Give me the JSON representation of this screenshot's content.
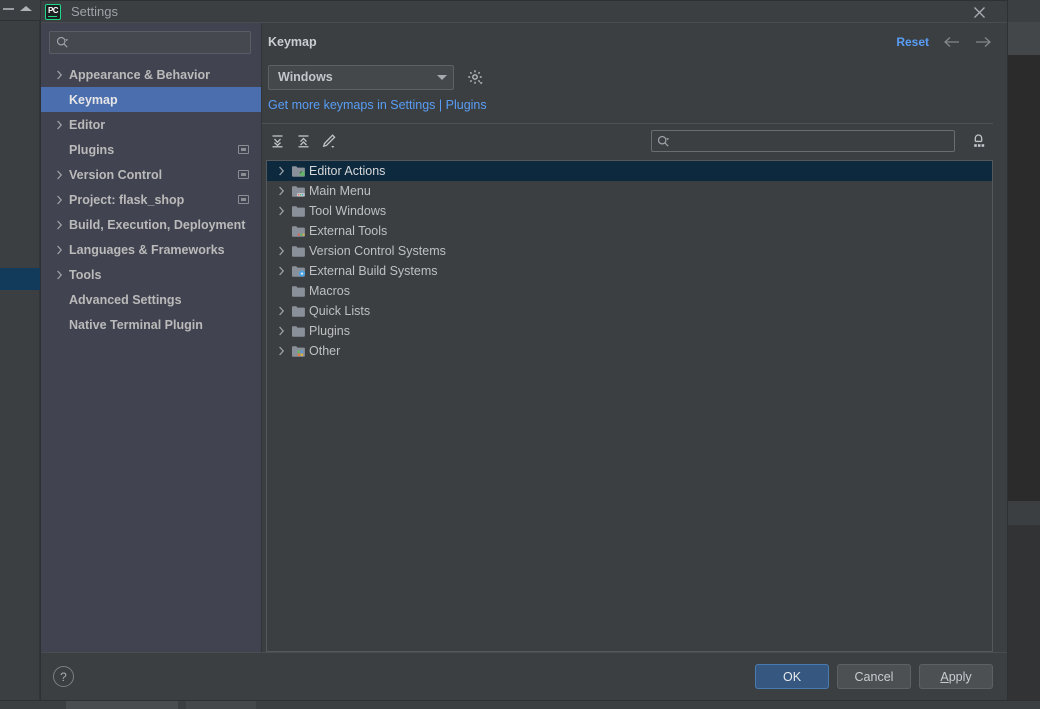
{
  "window": {
    "title": "Settings",
    "app_icon": "pycharm-icon",
    "app_icon_text": "PC",
    "close_icon": "close-icon"
  },
  "sidebar": {
    "search": {
      "value": "",
      "placeholder": "",
      "icon": "search-icon"
    },
    "items": [
      {
        "label": "Appearance & Behavior",
        "expandable": true,
        "selected": false,
        "badge": false
      },
      {
        "label": "Keymap",
        "expandable": false,
        "selected": true,
        "badge": false
      },
      {
        "label": "Editor",
        "expandable": true,
        "selected": false,
        "badge": false
      },
      {
        "label": "Plugins",
        "expandable": false,
        "selected": false,
        "badge": true
      },
      {
        "label": "Version Control",
        "expandable": true,
        "selected": false,
        "badge": true
      },
      {
        "label": "Project: flask_shop",
        "expandable": true,
        "selected": false,
        "badge": true
      },
      {
        "label": "Build, Execution, Deployment",
        "expandable": true,
        "selected": false,
        "badge": false
      },
      {
        "label": "Languages & Frameworks",
        "expandable": true,
        "selected": false,
        "badge": false
      },
      {
        "label": "Tools",
        "expandable": true,
        "selected": false,
        "badge": false
      },
      {
        "label": "Advanced Settings",
        "expandable": false,
        "selected": false,
        "badge": false
      },
      {
        "label": "Native Terminal Plugin",
        "expandable": false,
        "selected": false,
        "badge": false
      }
    ]
  },
  "content": {
    "page_title": "Keymap",
    "reset_label": "Reset",
    "back_icon": "arrow-left-icon",
    "forward_icon": "arrow-right-icon",
    "keymap_select": {
      "value": "Windows",
      "chevron": "chevron-down-icon"
    },
    "gear_icon": "gear-icon",
    "keymaps_link": "Get more keymaps in Settings | Plugins",
    "toolbar": {
      "expand_all_icon": "expand-all-icon",
      "collapse_all_icon": "collapse-all-icon",
      "edit_shortcut_icon": "pencil-edit-icon",
      "find_by_shortcut_icon": "find-by-shortcut-icon",
      "search": {
        "value": "",
        "placeholder": "",
        "icon": "search-icon"
      }
    },
    "tree": [
      {
        "label": "Editor Actions",
        "expandable": true,
        "selected": true,
        "icon": "folder-editor-icon"
      },
      {
        "label": "Main Menu",
        "expandable": true,
        "selected": false,
        "icon": "folder-menu-icon"
      },
      {
        "label": "Tool Windows",
        "expandable": true,
        "selected": false,
        "icon": "folder-icon"
      },
      {
        "label": "External Tools",
        "expandable": false,
        "selected": false,
        "icon": "folder-tools-icon"
      },
      {
        "label": "Version Control Systems",
        "expandable": true,
        "selected": false,
        "icon": "folder-icon"
      },
      {
        "label": "External Build Systems",
        "expandable": true,
        "selected": false,
        "icon": "folder-build-icon"
      },
      {
        "label": "Macros",
        "expandable": false,
        "selected": false,
        "icon": "folder-icon"
      },
      {
        "label": "Quick Lists",
        "expandable": true,
        "selected": false,
        "icon": "folder-icon"
      },
      {
        "label": "Plugins",
        "expandable": true,
        "selected": false,
        "icon": "folder-icon"
      },
      {
        "label": "Other",
        "expandable": true,
        "selected": false,
        "icon": "folder-other-icon"
      }
    ]
  },
  "footer": {
    "help_label": "?",
    "ok_label": "OK",
    "cancel_label": "Cancel",
    "apply_label_prefix": "A",
    "apply_label_rest": "pply"
  },
  "colors": {
    "accent_link": "#589DF6",
    "sidebar_selected": "#4B6EAF",
    "tree_selected": "#0D293E",
    "primary_button": "#365880",
    "dialog_bg": "#3C3F41",
    "sidebar_bg": "#414450",
    "brand_green": "#21D789"
  }
}
